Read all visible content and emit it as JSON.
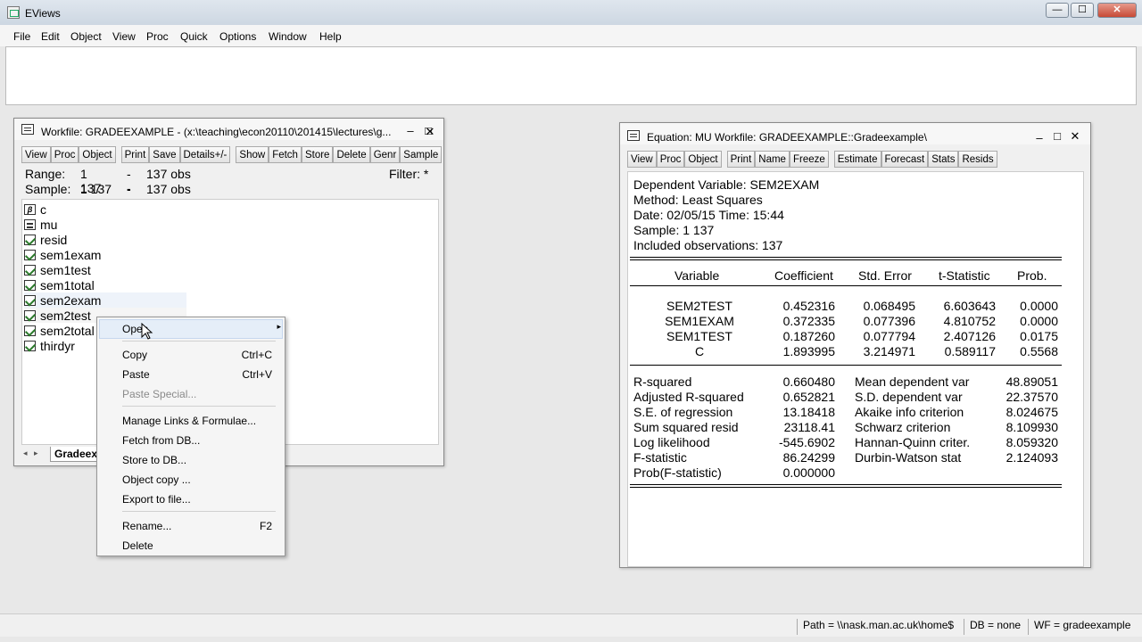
{
  "app": {
    "title": "EViews",
    "controls": {
      "minimize": "—",
      "maximize": "☐",
      "close": "✕"
    }
  },
  "menu": [
    "File",
    "Edit",
    "Object",
    "View",
    "Proc",
    "Quick",
    "Options",
    "Window",
    "Help"
  ],
  "workfile": {
    "title": "Workfile: GRADEEXAMPLE - (x:\\teaching\\econ20110\\201415\\lectures\\g...",
    "toolbar": [
      "View",
      "Proc",
      "Object",
      "Print",
      "Save",
      "Details+/-",
      "Show",
      "Fetch",
      "Store",
      "Delete",
      "Genr",
      "Sample"
    ],
    "range_label": "Range:",
    "range_value": "1 137",
    "range_sep": "--",
    "range_obs": "137 obs",
    "sample_label": "Sample:",
    "sample_value": "1 137",
    "sample_sep": "--",
    "sample_obs": "137 obs",
    "filter": "Filter: *",
    "objects": [
      {
        "name": "c",
        "icon": "coef-icon"
      },
      {
        "name": "mu",
        "icon": "equation-icon"
      },
      {
        "name": "resid",
        "icon": "series-icon"
      },
      {
        "name": "sem1exam",
        "icon": "series-icon"
      },
      {
        "name": "sem1test",
        "icon": "series-icon"
      },
      {
        "name": "sem1total",
        "icon": "series-icon"
      },
      {
        "name": "sem2exam",
        "icon": "series-icon"
      },
      {
        "name": "sem2test",
        "icon": "series-icon"
      },
      {
        "name": "sem2total",
        "icon": "series-icon"
      },
      {
        "name": "thirdyr",
        "icon": "series-icon"
      }
    ],
    "tab": "Gradeexa"
  },
  "context_menu": {
    "items": [
      {
        "label": "Open",
        "shortcut": "",
        "submenu": "▸"
      },
      {
        "label": "Copy",
        "shortcut": "Ctrl+C"
      },
      {
        "label": "Paste",
        "shortcut": "Ctrl+V"
      },
      {
        "label": "Paste Special...",
        "shortcut": ""
      },
      {
        "label": "Manage Links & Formulae...",
        "shortcut": ""
      },
      {
        "label": "Fetch from DB...",
        "shortcut": ""
      },
      {
        "label": "Store to DB...",
        "shortcut": ""
      },
      {
        "label": "Object copy ...",
        "shortcut": ""
      },
      {
        "label": "Export to file...",
        "shortcut": ""
      },
      {
        "label": "Rename...",
        "shortcut": "F2"
      },
      {
        "label": "Delete",
        "shortcut": ""
      }
    ]
  },
  "equation": {
    "title": "Equation: MU   Workfile: GRADEEXAMPLE::Gradeexample\\",
    "toolbar": [
      "View",
      "Proc",
      "Object",
      "Print",
      "Name",
      "Freeze",
      "Estimate",
      "Forecast",
      "Stats",
      "Resids"
    ],
    "header": [
      "Dependent Variable: SEM2EXAM",
      "Method: Least Squares",
      "Date: 02/05/15   Time: 15:44",
      "Sample: 1 137",
      "Included observations: 137"
    ],
    "columns": [
      "Variable",
      "Coefficient",
      "Std. Error",
      "t-Statistic",
      "Prob."
    ],
    "rows": [
      [
        "SEM2TEST",
        "0.452316",
        "0.068495",
        "6.603643",
        "0.0000"
      ],
      [
        "SEM1EXAM",
        "0.372335",
        "0.077396",
        "4.810752",
        "0.0000"
      ],
      [
        "SEM1TEST",
        "0.187260",
        "0.077794",
        "2.407126",
        "0.0175"
      ],
      [
        "C",
        "1.893995",
        "3.214971",
        "0.589117",
        "0.5568"
      ]
    ],
    "stats": [
      [
        "R-squared",
        "0.660480",
        "Mean dependent var",
        "48.89051"
      ],
      [
        "Adjusted R-squared",
        "0.652821",
        "S.D. dependent var",
        "22.37570"
      ],
      [
        "S.E. of regression",
        "13.18418",
        "Akaike info criterion",
        "8.024675"
      ],
      [
        "Sum squared resid",
        "23118.41",
        "Schwarz criterion",
        "8.109930"
      ],
      [
        "Log likelihood",
        "-545.6902",
        "Hannan-Quinn criter.",
        "8.059320"
      ],
      [
        "F-statistic",
        "86.24299",
        "Durbin-Watson stat",
        "2.124093"
      ],
      [
        "Prob(F-statistic)",
        "0.000000",
        "",
        ""
      ]
    ]
  },
  "status": {
    "path": "Path = \\\\nask.man.ac.uk\\home$",
    "db": "DB = none",
    "wf": "WF = gradeexample"
  }
}
